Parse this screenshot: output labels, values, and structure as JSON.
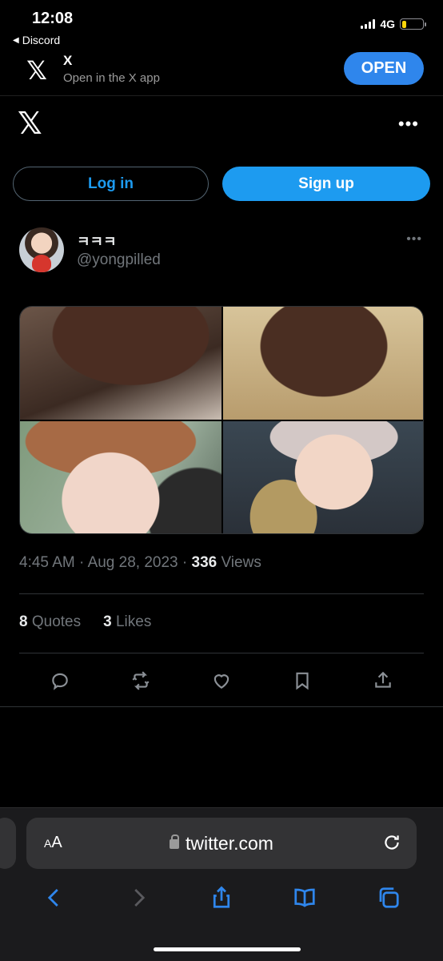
{
  "status_bar": {
    "time": "12:08",
    "back_app": "Discord",
    "network": "4G"
  },
  "app_banner": {
    "title": "X",
    "subtitle": "Open in the X app",
    "open_label": "OPEN"
  },
  "auth": {
    "login_label": "Log in",
    "signup_label": "Sign up"
  },
  "tweet": {
    "display_name": "ㅋㅋㅋ",
    "handle": "@yongpilled",
    "time": "4:45 AM",
    "sep1": " · ",
    "date": "Aug 28, 2023",
    "sep2": " · ",
    "views_count": "336",
    "views_label": " Views",
    "quotes_count": "8",
    "quotes_label": " Quotes",
    "likes_count": "3",
    "likes_label": " Likes"
  },
  "browser": {
    "aa_label": "AA",
    "url": "twitter.com"
  },
  "colors": {
    "accent": "#1d9bf0",
    "banner_button": "#2f86ec",
    "background": "#000000",
    "battery": "#ffd60a"
  }
}
